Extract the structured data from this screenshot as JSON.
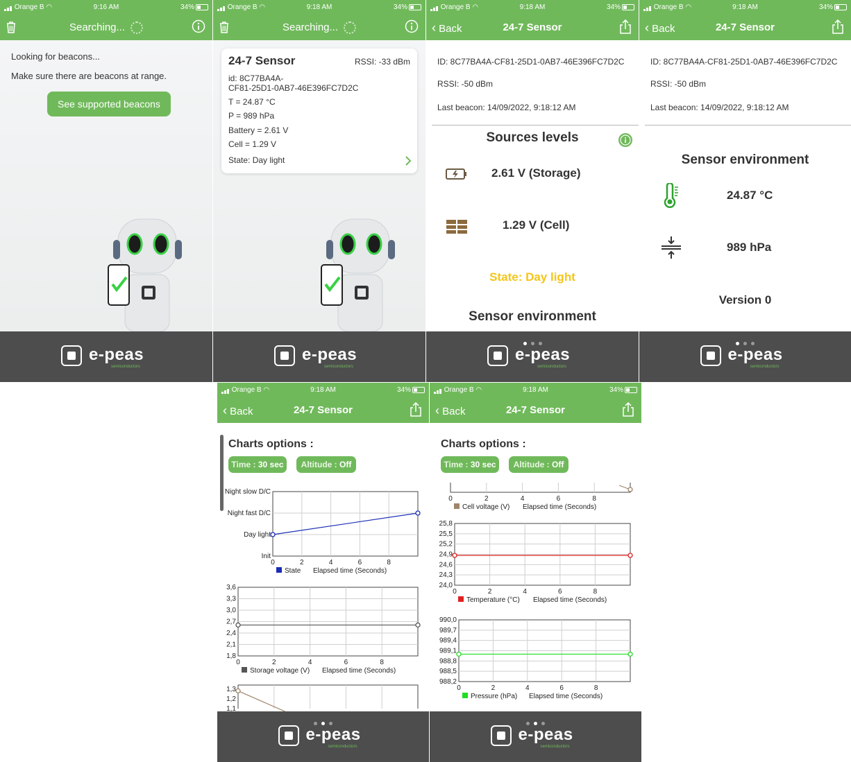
{
  "status_bar": {
    "carrier": "Orange B",
    "battery": "34%",
    "times": [
      "9:16 AM",
      "9:18 AM",
      "9:18 AM",
      "9:18 AM",
      "9:18 AM",
      "9:18 AM"
    ]
  },
  "colors": {
    "header_green": "#70b95b",
    "footer_gray": "#4d4d4d",
    "state_yellow": "#f5c518"
  },
  "footer": {
    "brand": "e-peas",
    "subtitle": "semiconductors"
  },
  "screen1": {
    "title": "Searching...",
    "looking": "Looking for beacons...",
    "hint": "Make sure there are beacons at range.",
    "button": "See supported beacons",
    "icons": {
      "left": "trash-icon",
      "right": "info-icon"
    }
  },
  "screen2": {
    "title": "Searching...",
    "card": {
      "name": "24-7 Sensor",
      "rssi": "RSSI: -33 dBm",
      "id_line1": "id: 8C77BA4A-",
      "id_line2": "CF81-25D1-0AB7-46E396FC7D2C",
      "temperature": "T = 24.87 °C",
      "pressure": "P = 989 hPa",
      "battery": "Battery = 2.61 V",
      "cell": "Cell = 1.29 V",
      "state": "State:  Day light"
    }
  },
  "screen3": {
    "back": "Back",
    "title": "24-7 Sensor",
    "id": "ID: 8C77BA4A-CF81-25D1-0AB7-46E396FC7D2C",
    "rssi": "RSSI: -50 dBm",
    "last_beacon": "Last beacon: 14/09/2022, 9:18:12 AM",
    "sources_title": "Sources levels",
    "storage": "2.61 V (Storage)",
    "cell": "1.29 V (Cell)",
    "state": "State:  Day light",
    "env_title": "Sensor environment"
  },
  "screen4": {
    "back": "Back",
    "title": "24-7 Sensor",
    "id": "ID: 8C77BA4A-CF81-25D1-0AB7-46E396FC7D2C",
    "rssi": "RSSI: -50 dBm",
    "last_beacon": "Last beacon: 14/09/2022, 9:18:12 AM",
    "env_title": "Sensor environment",
    "temperature": "24.87 °C",
    "pressure": "989 hPa",
    "version": "Version 0"
  },
  "screen5": {
    "back": "Back",
    "title": "24-7 Sensor",
    "options_title": "Charts options :",
    "time_label": "Time :",
    "time_value": "30 sec",
    "altitude_label": "Altitude :",
    "altitude_value": "Off"
  },
  "screen6": {
    "back": "Back",
    "title": "24-7 Sensor",
    "options_title": "Charts options :",
    "time_label": "Time :",
    "time_value": "30 sec",
    "altitude_label": "Altitude :",
    "altitude_value": "Off"
  },
  "chart_data": [
    {
      "type": "line",
      "name": "state-chart",
      "xlabel": "Elapsed time (Seconds)",
      "legend": "State",
      "legend_color": "#1a2db5",
      "xticks": [
        0,
        2,
        4,
        6,
        8
      ],
      "xlim": [
        0,
        10
      ],
      "ycategories": [
        "Init",
        "Day light",
        "Night fast D/C",
        "Night slow D/C"
      ],
      "x": [
        0,
        10
      ],
      "y": [
        1,
        2
      ]
    },
    {
      "type": "line",
      "name": "storage-chart",
      "xlabel": "Elapsed time (Seconds)",
      "legend": "Storage voltage (V)",
      "legend_color": "#555555",
      "xticks": [
        0,
        2,
        4,
        6,
        8
      ],
      "xlim": [
        0,
        10
      ],
      "yticks": [
        "3,6",
        "3,3",
        "3,0",
        "2,7",
        "2,4",
        "2,1",
        "1,8"
      ],
      "ylim": [
        1.8,
        3.6
      ],
      "x": [
        0,
        10
      ],
      "y": [
        2.61,
        2.61
      ]
    },
    {
      "type": "line",
      "name": "cell-chart-partial",
      "yticks": [
        "1,3",
        "1,2",
        "1,1"
      ],
      "x": [
        0,
        4
      ],
      "y": [
        1.29,
        1.1
      ]
    },
    {
      "type": "line",
      "name": "cell-chart-tail",
      "xlabel": "Elapsed time (Seconds)",
      "legend": "Cell voltage (V)",
      "legend_color": "#a0856a",
      "xticks": [
        0,
        2,
        4,
        6,
        8
      ],
      "xlim": [
        0,
        10
      ],
      "x": [
        0,
        10
      ]
    },
    {
      "type": "line",
      "name": "temperature-chart",
      "xlabel": "Elapsed time (Seconds)",
      "legend": "Temperature (°C)",
      "legend_color": "#e02020",
      "xticks": [
        0,
        2,
        4,
        6,
        8
      ],
      "xlim": [
        0,
        10
      ],
      "yticks": [
        "25,8",
        "25,5",
        "25,2",
        "24,9",
        "24,6",
        "24,3",
        "24,0"
      ],
      "ylim": [
        24.0,
        25.8
      ],
      "x": [
        0,
        10
      ],
      "y": [
        24.87,
        24.87
      ]
    },
    {
      "type": "line",
      "name": "pressure-chart",
      "xlabel": "Elapsed time (Seconds)",
      "legend": "Pressure (hPa)",
      "legend_color": "#22dd22",
      "xticks": [
        0,
        2,
        4,
        6,
        8
      ],
      "xlim": [
        0,
        10
      ],
      "yticks": [
        "990,0",
        "989,7",
        "989,4",
        "989,1",
        "988,8",
        "988,5",
        "988,2"
      ],
      "ylim": [
        988.2,
        990.0
      ],
      "x": [
        0,
        10
      ],
      "y": [
        989,
        989
      ]
    }
  ]
}
